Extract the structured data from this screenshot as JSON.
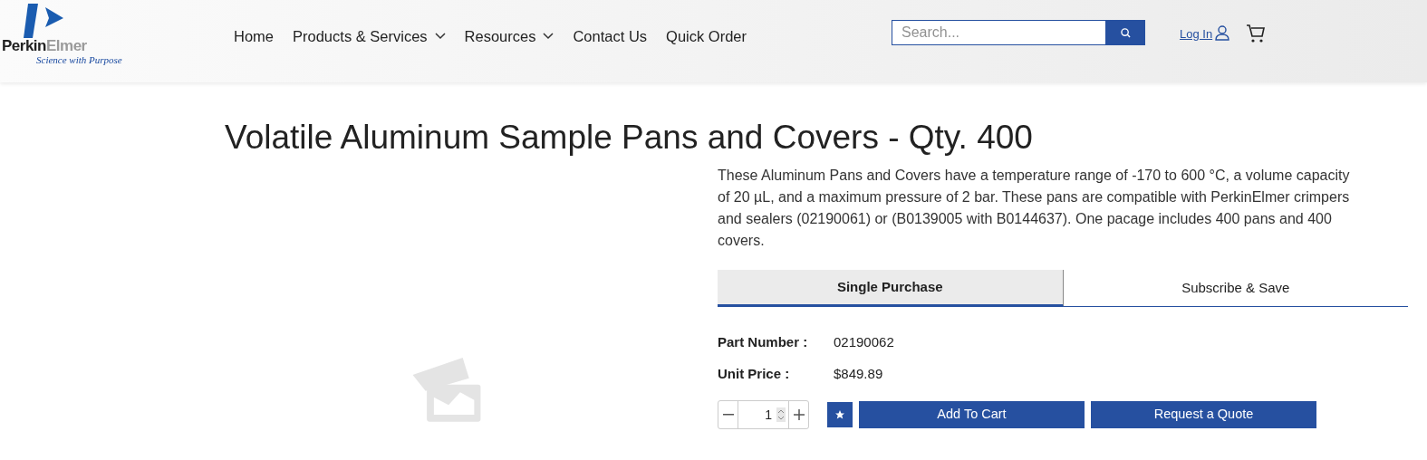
{
  "logo": {
    "name_dark": "Perkin",
    "name_light": "Elmer",
    "tagline": "Science with Purpose"
  },
  "nav": [
    {
      "label": "Home",
      "has_menu": false
    },
    {
      "label": "Products & Services",
      "has_menu": true
    },
    {
      "label": "Resources",
      "has_menu": true
    },
    {
      "label": "Contact Us",
      "has_menu": false
    },
    {
      "label": "Quick Order",
      "has_menu": false
    }
  ],
  "search": {
    "placeholder": "Search..."
  },
  "login": "Log In",
  "product": {
    "title": "Volatile Aluminum Sample Pans and Covers - Qty. 400",
    "description": "These Aluminum Pans and Covers have a temperature range of -170 to 600 °C, a volume capacity of 20 µL, and a maximum pressure of 2 bar. These pans are compatible with PerkinElmer crimpers and sealers (02190061) or (B0139005 with B0144637). One pacage includes 400 pans and 400 covers."
  },
  "tabs": [
    {
      "label": "Single Purchase",
      "selected": true
    },
    {
      "label": "Subscribe & Save",
      "selected": false
    }
  ],
  "details": [
    {
      "label": "Part Number :",
      "value": "02190062"
    },
    {
      "label": "Unit Price :",
      "value": "$849.89"
    }
  ],
  "quantity": "1",
  "buttons": [
    "Add To Cart",
    "Request a Quote"
  ]
}
